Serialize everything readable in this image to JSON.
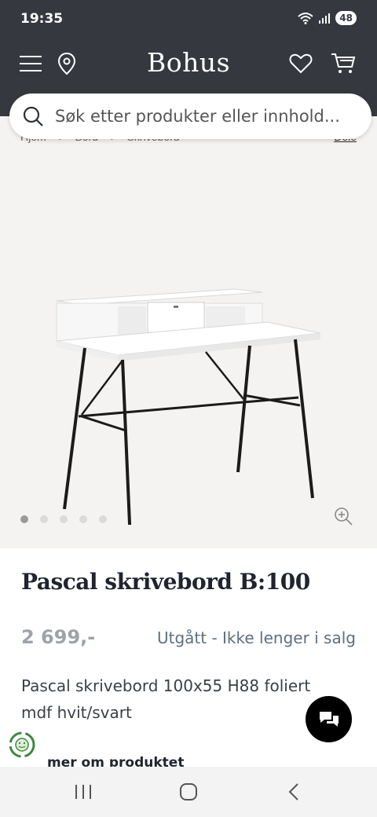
{
  "status": {
    "time": "19:35",
    "battery": "48"
  },
  "header": {
    "logo": "Bohus"
  },
  "search": {
    "placeholder": "Søk etter produkter eller innhold..."
  },
  "breadcrumb": {
    "items": [
      "Hjem",
      "Bord",
      "Skrivebord"
    ],
    "right": "Dele"
  },
  "gallery": {
    "dot_count": 5,
    "active_index": 0
  },
  "product": {
    "title": "Pascal skrivebord B:100",
    "price": "2 699,-",
    "availability": "Utgått - Ikke lenger i salg",
    "description": "Pascal skrivebord 100x55 H88 foliert mdf hvit/svart",
    "more_label": "mer om produktet"
  },
  "colors": {
    "header_bg": "#35383f",
    "gallery_bg": "#f5f3f1",
    "price": "#9ea3aa",
    "availability": "#5d7080"
  }
}
